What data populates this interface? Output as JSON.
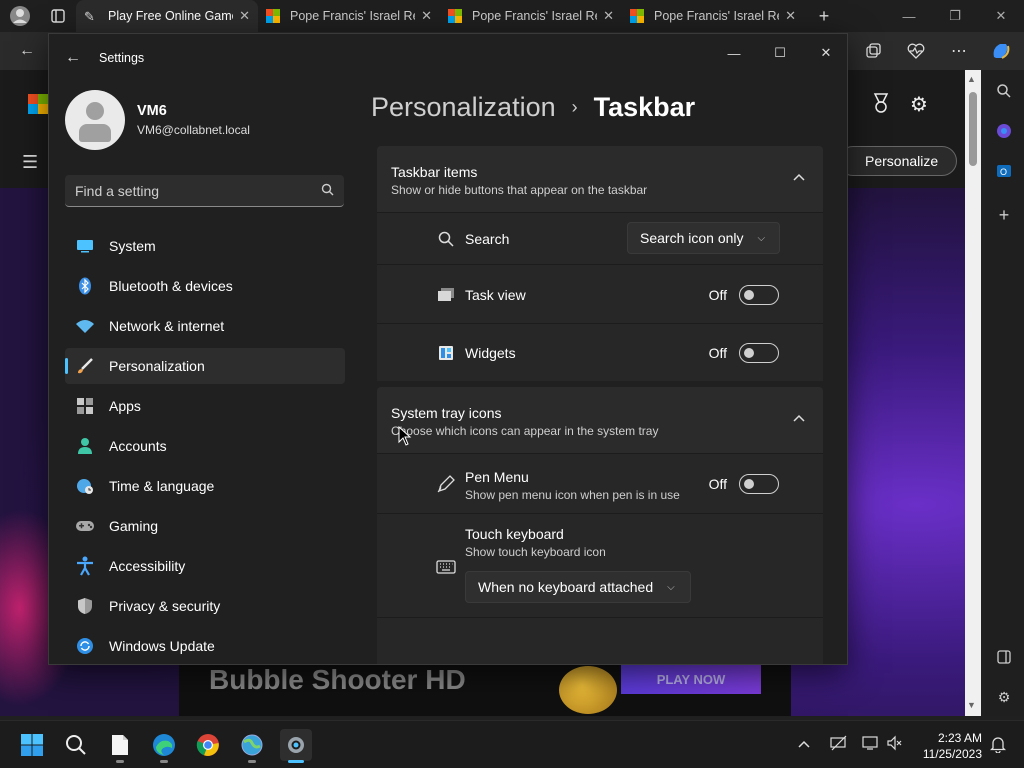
{
  "browser": {
    "tabs": [
      {
        "title": "Play Free Online Games",
        "active": true
      },
      {
        "title": "Pope Francis' Israel Re",
        "active": false
      },
      {
        "title": "Pope Francis' Israel Re",
        "active": false
      },
      {
        "title": "Pope Francis' Israel Re",
        "active": false
      }
    ]
  },
  "site": {
    "personalize_label": "Personalize",
    "game_title": "Bubble Shooter HD",
    "play_label": "PLAY NOW"
  },
  "settings": {
    "window_title": "Settings",
    "user": {
      "name": "VM6",
      "email": "VM6@collabnet.local"
    },
    "search_placeholder": "Find a setting",
    "nav": [
      {
        "label": "System",
        "icon": "monitor-icon",
        "color": "#4cc2ff"
      },
      {
        "label": "Bluetooth & devices",
        "icon": "bluetooth-icon",
        "color": "#3b8fe6"
      },
      {
        "label": "Network & internet",
        "icon": "wifi-icon",
        "color": "#5fb8f0"
      },
      {
        "label": "Personalization",
        "icon": "brush-icon",
        "color": "#f0a24c",
        "selected": true
      },
      {
        "label": "Apps",
        "icon": "apps-icon",
        "color": "#a8a8a8"
      },
      {
        "label": "Accounts",
        "icon": "person-icon",
        "color": "#3fc6a6"
      },
      {
        "label": "Time & language",
        "icon": "globe-clock-icon",
        "color": "#4ea8e8"
      },
      {
        "label": "Gaming",
        "icon": "gamepad-icon",
        "color": "#a8a8a8"
      },
      {
        "label": "Accessibility",
        "icon": "accessibility-icon",
        "color": "#4aa8ff"
      },
      {
        "label": "Privacy & security",
        "icon": "shield-icon",
        "color": "#9a9a9a"
      },
      {
        "label": "Windows Update",
        "icon": "update-icon",
        "color": "#2f8fe6"
      }
    ],
    "breadcrumb": {
      "parent": "Personalization",
      "current": "Taskbar"
    },
    "taskbar_items": {
      "title": "Taskbar items",
      "subtitle": "Show or hide buttons that appear on the taskbar",
      "search": {
        "label": "Search",
        "value": "Search icon only"
      },
      "task_view": {
        "label": "Task view",
        "state": "Off"
      },
      "widgets": {
        "label": "Widgets",
        "state": "Off"
      }
    },
    "system_tray": {
      "title": "System tray icons",
      "subtitle": "Choose which icons can appear in the system tray",
      "pen_menu": {
        "label": "Pen Menu",
        "desc": "Show pen menu icon when pen is in use",
        "state": "Off"
      },
      "touch_keyboard": {
        "label": "Touch keyboard",
        "desc": "Show touch keyboard icon",
        "value": "When no keyboard attached"
      }
    }
  },
  "taskbar": {
    "time": "2:23 AM",
    "date": "11/25/2023"
  }
}
